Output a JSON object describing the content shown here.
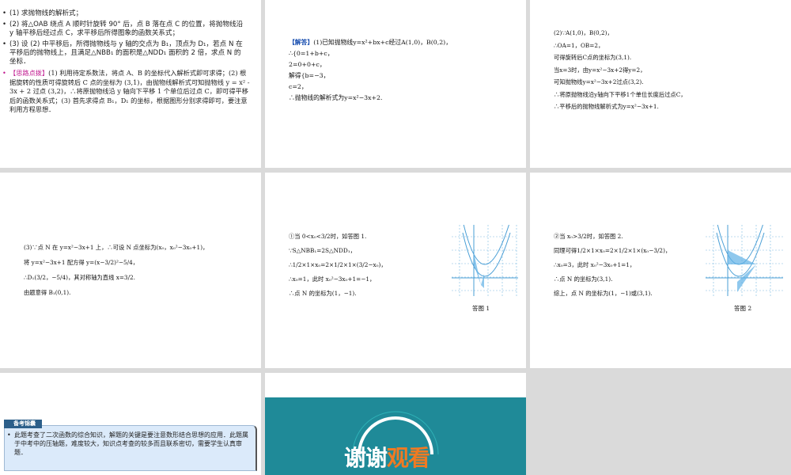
{
  "slide1": {
    "items": [
      "(1) 求抛物线的解析式；",
      "(2) 将△OAB 绕点 A 顺时针旋转 90° 后，点 B 落在点 C 的位置，将抛物线沿 y 轴平移后经过点 C，求平移后所得图象的函数关系式；",
      "(3) 设 (2) 中平移后，所得抛物线与 y 轴的交点为 B₁，顶点为 D₁，若点 N 在平移后的抛物线上，且满足△NBB₁ 的面积是△NDD₁ 面积的 2 倍，求点 N 的坐标．"
    ],
    "hint_label": "【思路点拨】",
    "hint": "(1) 利用待定系数法，将点 A、B 的坐标代入解析式即可求得；(2) 根据旋转的性质可得旋转后 C 点的坐标为 (3,1)，由抛物线解析式可知抛物线 y = x² - 3x + 2 过点 (3,2)，∴将原抛物线沿 y 轴向下平移 1 个单位后过点 C，即可得平移后的函数关系式；(3) 首先求得点 B₁，D₁ 的坐标，根据图形分别求得即可，要注意利用方程思想．"
  },
  "slide2": {
    "answer_label": "【解答】",
    "lines": [
      "(1)已知抛物线y=x²+bx+c经过A(1,0)，B(0,2)，",
      "∴{0=1+b+c，",
      "  2=0+0+c，",
      "解得{b=−3，",
      "  c=2，",
      "∴抛物线的解析式为y=x²−3x+2."
    ]
  },
  "slide3": {
    "lines": [
      "(2)∵A(1,0)，B(0,2)，",
      "∴OA=1，OB=2，",
      "可得旋转后C点的坐标为(3,1).",
      "当x=3时，由y=x²−3x+2得y=2，",
      "可知抛物线y=x²−3x+2过点(3,2).",
      "∴将原抛物线沿y轴向下平移1个单位长度后过点C，",
      "∴平移后的抛物线解析式为y=x²−3x+1."
    ]
  },
  "slide4": {
    "lines": [
      "(3)∵点 N 在 y=x²−3x+1 上，∴可设 N 点坐标为(x₀，x₀²−3x₀+1)，",
      "将 y=x²−3x+1 配方得 y=(x−3/2)²−5/4，",
      "∴D₁(3/2，−5/4)，其对称轴为直线 x=3/2.",
      "由题意得 B₁(0,1)."
    ]
  },
  "slide5": {
    "lines": [
      "①当 0<x₀<3/2时，如答图 1.",
      "∵S△NBB₁=2S△NDD₁，",
      "∴1/2×1×x₀=2×1/2×1×(3/2−x₀)，",
      "∴x₀=1，此时 x₀²−3x₀+1=−1，",
      "∴点 N 的坐标为(1，−1)."
    ],
    "caption": "答图 1"
  },
  "slide6": {
    "lines": [
      "②当 x₀>3/2时，如答图 2.",
      "同理可得1/2×1×x₀=2×1/2×1×(x₀−3/2)，",
      "∴x₀=3，此时 x₀²−3x₀+1=1，",
      "∴点 N 的坐标为(3,1).",
      "综上，点 N 的坐标为(1，−1)或(3,1)."
    ],
    "caption": "答图 2"
  },
  "slide7": {
    "tag": "备考锦囊",
    "text": "此题考查了二次函数的综合知识，解题的关键是要注意数形结合思想的应用．此题属于中考中的压轴题，难度较大，知识点考查的较多而且联系密切，需要学生认真审题．"
  },
  "slide8": {
    "title_white": "谢谢",
    "title_orange": "观看",
    "colors": {
      "bg": "#1f8a98",
      "orange": "#f07a22"
    }
  }
}
